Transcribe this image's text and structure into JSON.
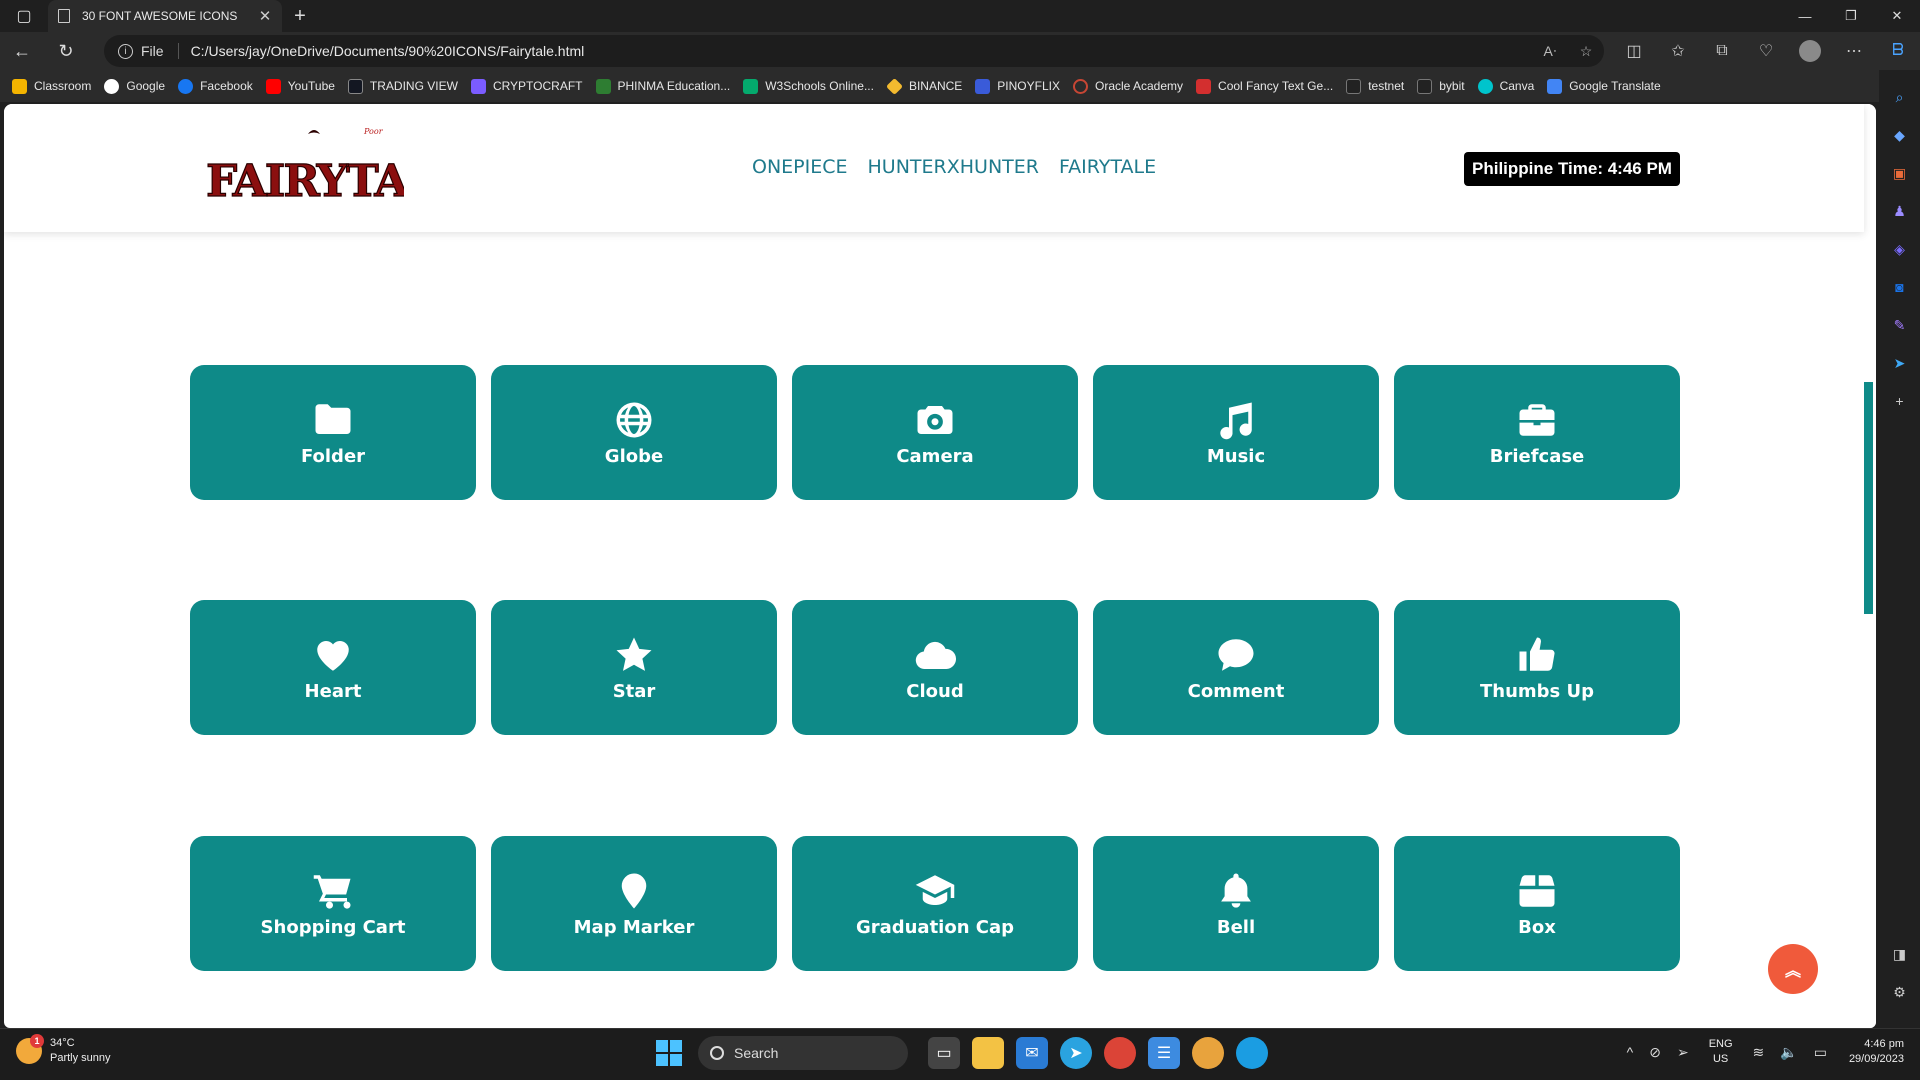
{
  "browser": {
    "tab_title": "30 FONT AWESOME ICONS",
    "address_scheme": "File",
    "url": "C:/Users/jay/OneDrive/Documents/90%20ICONS/Fairytale.html",
    "bookmarks": [
      {
        "label": "Classroom",
        "color": "#f4b400"
      },
      {
        "label": "Google",
        "color": "#ffffff"
      },
      {
        "label": "Facebook",
        "color": "#1877f2"
      },
      {
        "label": "YouTube",
        "color": "#ff0000"
      },
      {
        "label": "TRADING VIEW",
        "color": "#131722"
      },
      {
        "label": "CRYPTOCRAFT",
        "color": "#7b5cff"
      },
      {
        "label": "PHINMA Education...",
        "color": "#2e7d32"
      },
      {
        "label": "W3Schools Online...",
        "color": "#04aa6d"
      },
      {
        "label": "BINANCE",
        "color": "#f3ba2f"
      },
      {
        "label": "PINOYFLIX",
        "color": "#3a5bd9"
      },
      {
        "label": "Oracle Academy",
        "color": "#c74634"
      },
      {
        "label": "Cool Fancy Text Ge...",
        "color": "#d32f2f"
      },
      {
        "label": "testnet",
        "color": "#222222"
      },
      {
        "label": "bybit",
        "color": "#222222"
      },
      {
        "label": "Canva",
        "color": "#00c4cc"
      },
      {
        "label": "Google Translate",
        "color": "#4285f4"
      }
    ]
  },
  "site": {
    "logo_text": "FAIRYTAIL",
    "nav": [
      "ONEPIECE",
      "HUNTERXHUNTER",
      "FAIRYTALE"
    ],
    "clock": "Philippine Time: 4:46 PM",
    "accent": "#0e8a88",
    "cards": [
      {
        "label": "Folder",
        "icon": "folder-icon"
      },
      {
        "label": "Globe",
        "icon": "globe-icon"
      },
      {
        "label": "Camera",
        "icon": "camera-icon"
      },
      {
        "label": "Music",
        "icon": "music-icon"
      },
      {
        "label": "Briefcase",
        "icon": "briefcase-icon"
      },
      {
        "label": "Heart",
        "icon": "heart-icon"
      },
      {
        "label": "Star",
        "icon": "star-icon"
      },
      {
        "label": "Cloud",
        "icon": "cloud-icon"
      },
      {
        "label": "Comment",
        "icon": "comment-icon"
      },
      {
        "label": "Thumbs Up",
        "icon": "thumbs-up-icon"
      },
      {
        "label": "Shopping Cart",
        "icon": "shopping-cart-icon"
      },
      {
        "label": "Map Marker",
        "icon": "map-marker-icon"
      },
      {
        "label": "Graduation Cap",
        "icon": "graduation-cap-icon"
      },
      {
        "label": "Bell",
        "icon": "bell-icon"
      },
      {
        "label": "Box",
        "icon": "box-icon"
      }
    ]
  },
  "taskbar": {
    "weather_temp": "34°C",
    "weather_desc": "Partly sunny",
    "weather_badge": "1",
    "search_placeholder": "Search",
    "lang_top": "ENG",
    "lang_bottom": "US",
    "time": "4:46 pm",
    "date": "29/09/2023"
  }
}
